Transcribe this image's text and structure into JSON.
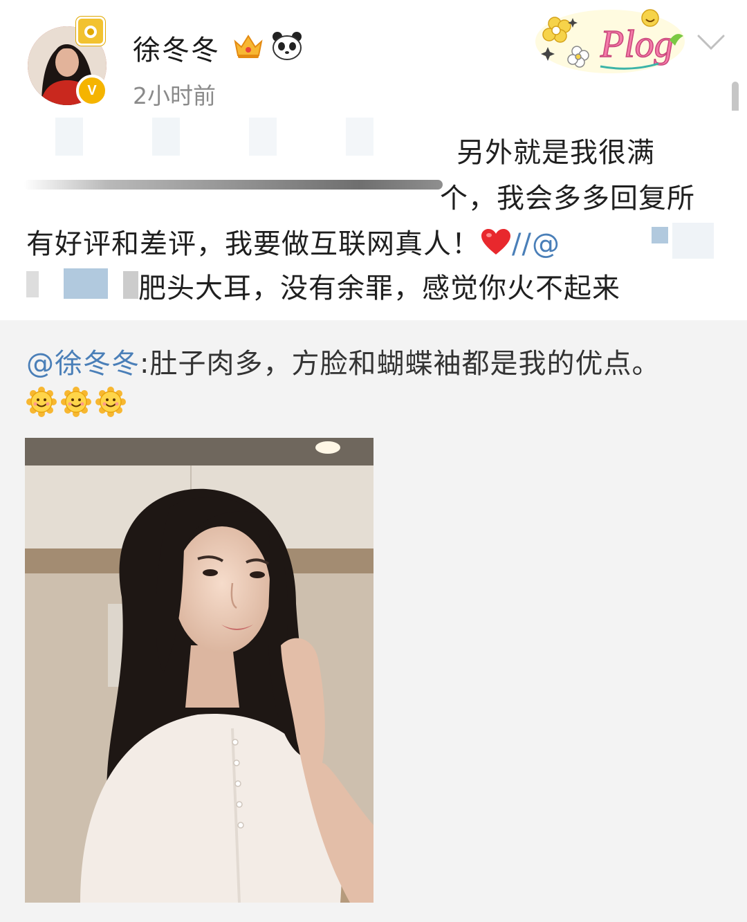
{
  "post": {
    "username": "徐冬冬",
    "time": "2小时前",
    "line1": "另外就是我很满",
    "line2": "个，我会多多回复所",
    "line3": "有好评和差评，我要做互联网真人！",
    "line3_mention": "//@",
    "line4_prefix": "…",
    "line4": "肥头大耳，没有余罪，感觉你火不起来"
  },
  "repost": {
    "mention": "@徐冬冬",
    "text": ":肚子肉多，方脸和蝴蝶袖都是我的优点。",
    "emoji_count": 3
  },
  "icons": {
    "verified": "V",
    "sticker": "Plog"
  },
  "colors": {
    "link": "#4a7fb8",
    "verified": "#f5b400",
    "repost_bg": "#f3f3f3"
  }
}
